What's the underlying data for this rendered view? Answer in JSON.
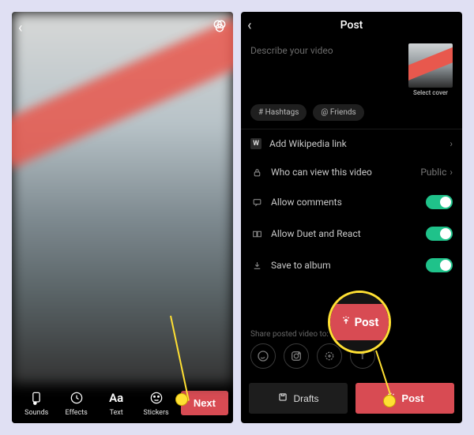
{
  "left": {
    "tools": {
      "sounds": "Sounds",
      "effects": "Effects",
      "text": "Text",
      "stickers": "Stickers"
    },
    "next": "Next"
  },
  "right": {
    "title": "Post",
    "describe_placeholder": "Describe your video",
    "cover_label": "Select cover",
    "chips": {
      "hashtags": "# Hashtags",
      "friends": "@ Friends"
    },
    "settings": {
      "wikipedia": "Add Wikipedia link",
      "privacy_label": "Who can view this video",
      "privacy_value": "Public",
      "comments": "Allow comments",
      "duet": "Allow Duet and React",
      "save": "Save to album"
    },
    "share_label": "Share posted video to:",
    "drafts": "Drafts",
    "post": "Post"
  },
  "callout": {
    "post": "Post"
  }
}
